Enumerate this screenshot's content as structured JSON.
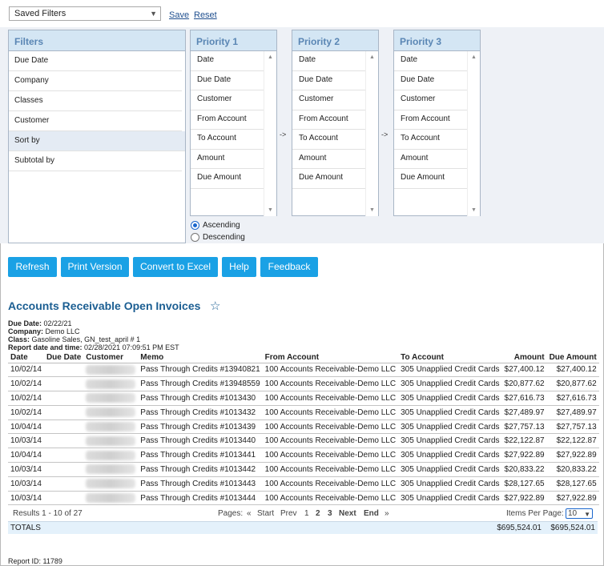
{
  "toolbar": {
    "saved_filters": "Saved Filters",
    "save": "Save",
    "reset": "Reset"
  },
  "filters": {
    "title": "Filters",
    "items": [
      "Due Date",
      "Company",
      "Classes",
      "Customer",
      "Sort by",
      "Subtotal by"
    ],
    "active": "Sort by"
  },
  "priorities": [
    {
      "title": "Priority 1",
      "items": [
        "Date",
        "Due Date",
        "Customer",
        "From Account",
        "To Account",
        "Amount",
        "Due Amount"
      ]
    },
    {
      "title": "Priority 2",
      "items": [
        "Date",
        "Due Date",
        "Customer",
        "From Account",
        "To Account",
        "Amount",
        "Due Amount"
      ]
    },
    {
      "title": "Priority 3",
      "items": [
        "Date",
        "Due Date",
        "Customer",
        "From Account",
        "To Account",
        "Amount",
        "Due Amount"
      ]
    }
  ],
  "arrow": "->",
  "sort_order": {
    "ascending": "Ascending",
    "descending": "Descending",
    "selected": "Ascending"
  },
  "buttons": {
    "refresh": "Refresh",
    "print": "Print Version",
    "excel": "Convert to Excel",
    "help": "Help",
    "feedback": "Feedback"
  },
  "report": {
    "title": "Accounts Receivable Open Invoices",
    "due_date_label": "Due Date:",
    "due_date": "02/22/21",
    "company_label": "Company:",
    "company": "Demo LLC",
    "class_label": "Class:",
    "class": "Gasoline Sales, GN_test_april # 1",
    "report_date_label": "Report date and time:",
    "report_date": "02/28/2021 07:09:51 PM EST",
    "columns": [
      "Date",
      "Due Date",
      "Customer",
      "Memo",
      "From Account",
      "To Account",
      "Amount",
      "Due Amount"
    ],
    "rows": [
      {
        "date": "10/02/14",
        "due": "",
        "memo": "Pass Through Credits #13940821",
        "from": "100 Accounts Receivable-Demo LLC",
        "to": "305 Unapplied Credit Cards",
        "amount": "$27,400.12",
        "due_amount": "$27,400.12"
      },
      {
        "date": "10/02/14",
        "due": "",
        "memo": "Pass Through Credits #13948559",
        "from": "100 Accounts Receivable-Demo LLC",
        "to": "305 Unapplied Credit Cards",
        "amount": "$20,877.62",
        "due_amount": "$20,877.62"
      },
      {
        "date": "10/02/14",
        "due": "",
        "memo": "Pass Through Credits #1013430",
        "from": "100 Accounts Receivable-Demo LLC",
        "to": "305 Unapplied Credit Cards",
        "amount": "$27,616.73",
        "due_amount": "$27,616.73"
      },
      {
        "date": "10/02/14",
        "due": "",
        "memo": "Pass Through Credits #1013432",
        "from": "100 Accounts Receivable-Demo LLC",
        "to": "305 Unapplied Credit Cards",
        "amount": "$27,489.97",
        "due_amount": "$27,489.97"
      },
      {
        "date": "10/04/14",
        "due": "",
        "memo": "Pass Through Credits #1013439",
        "from": "100 Accounts Receivable-Demo LLC",
        "to": "305 Unapplied Credit Cards",
        "amount": "$27,757.13",
        "due_amount": "$27,757.13"
      },
      {
        "date": "10/03/14",
        "due": "",
        "memo": "Pass Through Credits #1013440",
        "from": "100 Accounts Receivable-Demo LLC",
        "to": "305 Unapplied Credit Cards",
        "amount": "$22,122.87",
        "due_amount": "$22,122.87"
      },
      {
        "date": "10/04/14",
        "due": "",
        "memo": "Pass Through Credits #1013441",
        "from": "100 Accounts Receivable-Demo LLC",
        "to": "305 Unapplied Credit Cards",
        "amount": "$27,922.89",
        "due_amount": "$27,922.89"
      },
      {
        "date": "10/03/14",
        "due": "",
        "memo": "Pass Through Credits #1013442",
        "from": "100 Accounts Receivable-Demo LLC",
        "to": "305 Unapplied Credit Cards",
        "amount": "$20,833.22",
        "due_amount": "$20,833.22"
      },
      {
        "date": "10/03/14",
        "due": "",
        "memo": "Pass Through Credits #1013443",
        "from": "100 Accounts Receivable-Demo LLC",
        "to": "305 Unapplied Credit Cards",
        "amount": "$28,127.65",
        "due_amount": "$28,127.65"
      },
      {
        "date": "10/03/14",
        "due": "",
        "memo": "Pass Through Credits #1013444",
        "from": "100 Accounts Receivable-Demo LLC",
        "to": "305 Unapplied Credit Cards",
        "amount": "$27,922.89",
        "due_amount": "$27,922.89"
      }
    ],
    "results": "Results 1 - 10 of 27",
    "pages_label": "Pages:",
    "first": "«",
    "start": "Start",
    "prev": "Prev",
    "page_numbers": [
      "1",
      "2",
      "3"
    ],
    "current_page": "1",
    "next": "Next",
    "end": "End",
    "last": "»",
    "items_per_page_label": "Items Per Page:",
    "items_per_page": "10",
    "totals_label": "TOTALS",
    "total_amount": "$695,524.01",
    "total_due": "$695,524.01",
    "report_id": "Report ID: 11789"
  }
}
